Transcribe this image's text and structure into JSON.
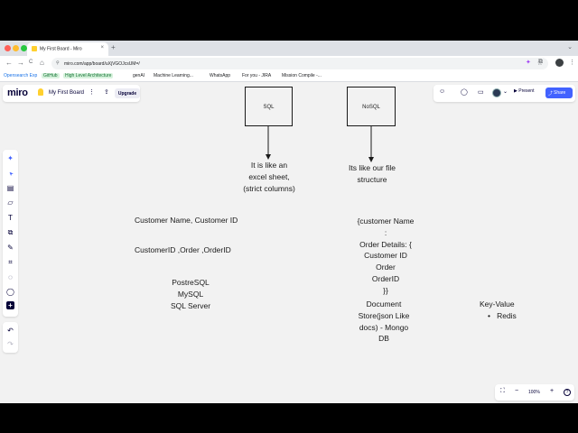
{
  "browser": {
    "tab_title": "My First Board - Miro",
    "url": "miro.com/app/board/uXjVGOJcsUM=/",
    "bookmarks": [
      {
        "label": "Opensearch Exp"
      },
      {
        "label": "GitHub"
      },
      {
        "label": "High Level Architecture"
      },
      {
        "label": "genAI"
      },
      {
        "label": "Machine Learning..."
      },
      {
        "label": "WhatsApp"
      },
      {
        "label": "For you - JIRA"
      },
      {
        "label": "Mission Compile -..."
      }
    ]
  },
  "miro": {
    "logo": "miro",
    "board_name": "My First Board",
    "upgrade_label": "Upgrade",
    "present_label": "Present",
    "share_label": "Share",
    "zoom_level": "100%"
  },
  "icons": {
    "close": "×",
    "plus": "+",
    "back": "←",
    "forward": "→",
    "reload": "C",
    "home": "⌂",
    "star": "☆",
    "lock": "⚲",
    "ai": "✦",
    "cursor": "➤",
    "frame": "▤",
    "sticky": "▱",
    "text": "T",
    "shapes": "⧉",
    "pen": "✎",
    "crop": "⌗",
    "comment": "◌",
    "chat": "◯",
    "add": "+",
    "undo": "↶",
    "redo": "↷",
    "fit": "⛶",
    "minus": "−",
    "help": "?",
    "more": "⋮",
    "upload": "⇪",
    "reactions": "☺",
    "video": "▭",
    "chevron": "⌄",
    "play": "▶",
    "share": "⤴"
  },
  "canvas": {
    "sql_box": {
      "label": "SQL"
    },
    "nosql_box": {
      "label": "NoSQL"
    },
    "sql_note": [
      "It is like an",
      "excel sheet,",
      "(strict columns)"
    ],
    "nosql_note": [
      "Its like our file",
      "structure"
    ],
    "customer_name": "Customer Name, Customer ID",
    "customer_order": "CustomerID ,Order ,OrderID",
    "sql_dbs": [
      "PostreSQL",
      "MySQL",
      "SQL Server"
    ],
    "json_note": [
      "{customer Name",
      ":",
      "Order Details: {",
      "Customer ID",
      "Order",
      "OrderID",
      "}}"
    ],
    "document_note": [
      "Document",
      "Store(json Like",
      "docs) - Mongo",
      "DB"
    ],
    "kv_note": {
      "title": "Key-Value",
      "bullet": "•",
      "item": "Redis"
    }
  }
}
